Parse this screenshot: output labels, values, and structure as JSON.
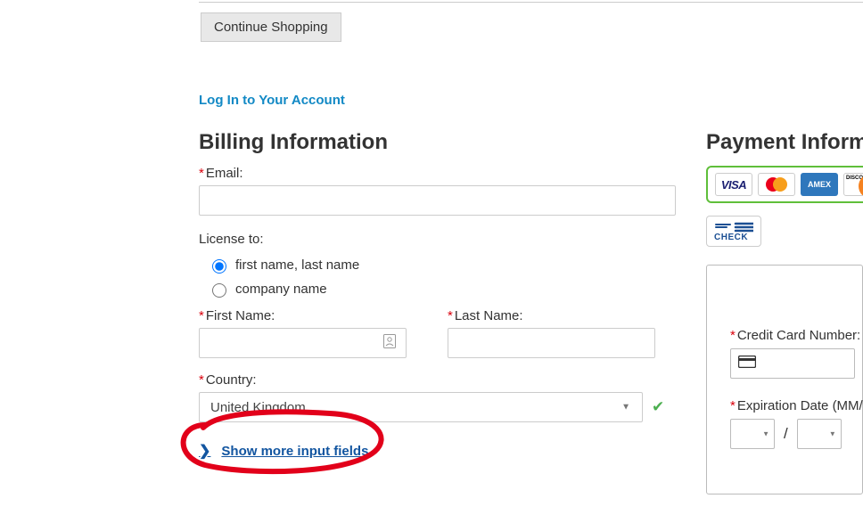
{
  "continue_button": "Continue Shopping",
  "login_link": "Log In to Your Account",
  "billing": {
    "title": "Billing Information",
    "email_label": "Email:",
    "email_value": "",
    "license_label": "License to:",
    "license_options": {
      "personal": "first name, last name",
      "company": "company name"
    },
    "first_name_label": "First Name:",
    "first_name_value": "",
    "last_name_label": "Last Name:",
    "last_name_value": "",
    "country_label": "Country:",
    "country_value": "United Kingdom",
    "show_more": "Show more input fields"
  },
  "payment": {
    "title": "Payment Information",
    "brands": {
      "visa": "VISA",
      "amex": "AMEX",
      "discover": "DISCOVER"
    },
    "check_label": "CHECK",
    "cc_label": "Credit Card Number:",
    "cc_value": "",
    "exp_label": "Expiration Date (MM/YYYY):",
    "exp_sep": "/"
  }
}
